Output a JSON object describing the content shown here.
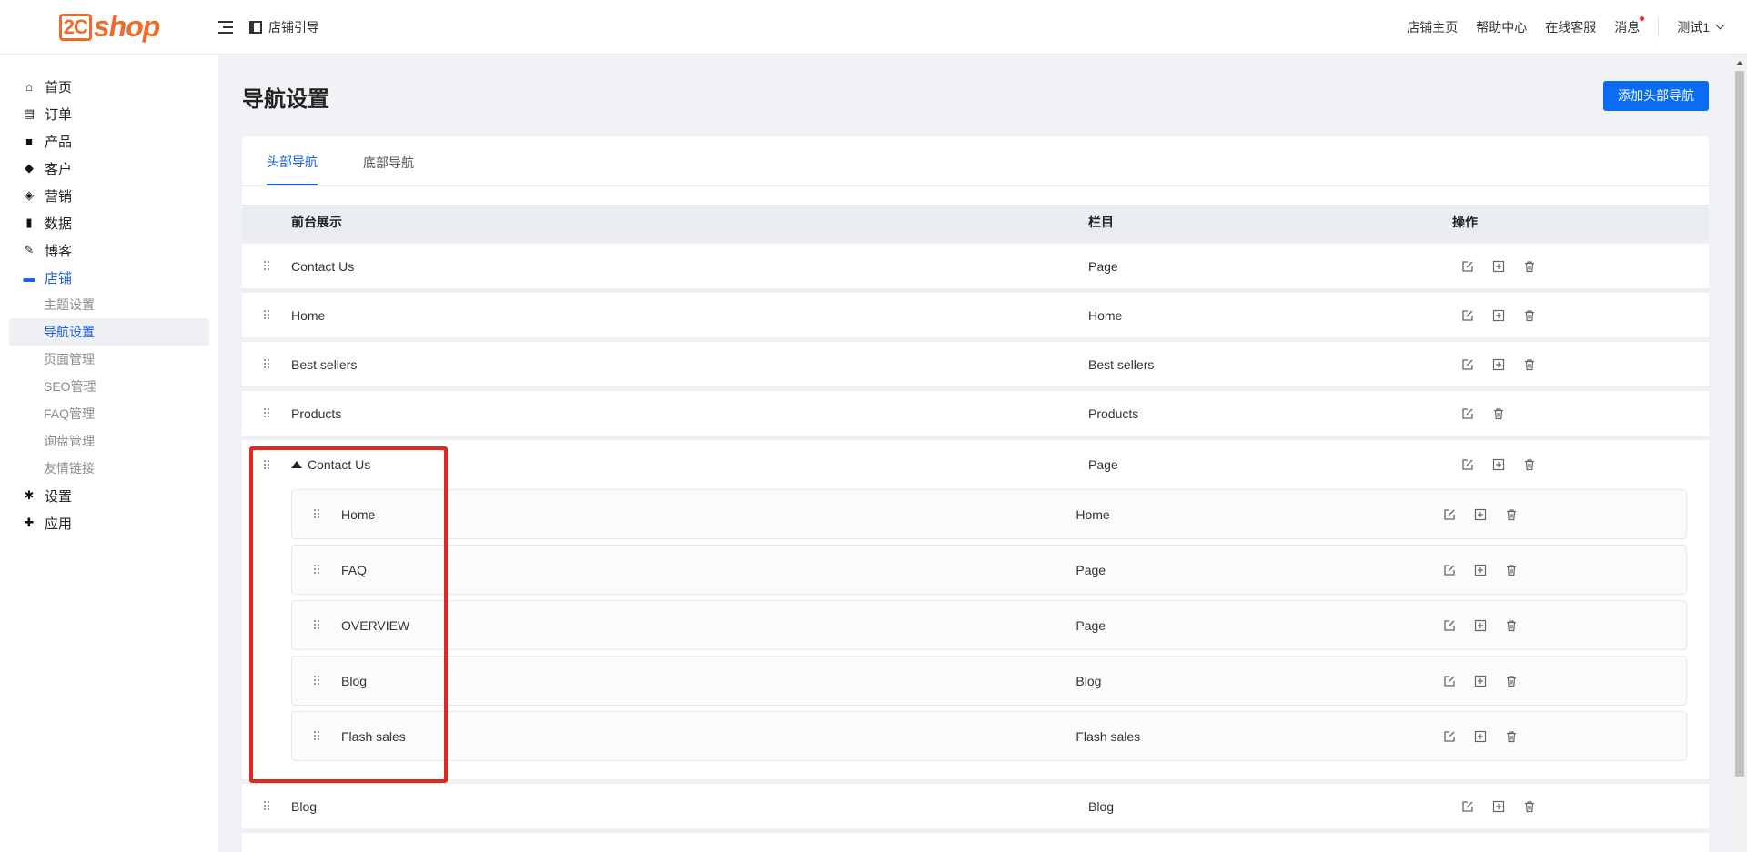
{
  "header": {
    "logo_mark": "2C",
    "logo_text": "shop",
    "breadcrumb": "店铺引导",
    "nav": [
      "店铺主页",
      "帮助中心",
      "在线客服",
      "消息"
    ],
    "user": "测试1"
  },
  "sidebar": {
    "items": [
      {
        "label": "首页",
        "icon": "home-icon"
      },
      {
        "label": "订单",
        "icon": "clipboard-icon"
      },
      {
        "label": "产品",
        "icon": "bag-icon"
      },
      {
        "label": "客户",
        "icon": "diamond-icon"
      },
      {
        "label": "营销",
        "icon": "tag-icon"
      },
      {
        "label": "数据",
        "icon": "bar-chart-icon"
      },
      {
        "label": "博客",
        "icon": "edit-note-icon"
      },
      {
        "label": "店铺",
        "icon": "store-icon"
      }
    ],
    "sub_items": [
      "主题设置",
      "导航设置",
      "页面管理",
      "SEO管理",
      "FAQ管理",
      "询盘管理",
      "友情链接"
    ],
    "bottom_items": [
      {
        "label": "设置",
        "icon": "gear-icon"
      },
      {
        "label": "应用",
        "icon": "puzzle-icon"
      }
    ]
  },
  "page": {
    "title": "导航设置",
    "add_button": "添加头部导航"
  },
  "tabs": [
    "头部导航",
    "底部导航"
  ],
  "table": {
    "headers": [
      "前台展示",
      "栏目",
      "操作"
    ],
    "rows": [
      {
        "name": "Contact Us",
        "column": "Page"
      },
      {
        "name": "Home",
        "column": "Home"
      },
      {
        "name": "Best sellers",
        "column": "Best sellers"
      },
      {
        "name": "Products",
        "column": "Products"
      }
    ],
    "group": {
      "name": "Contact Us",
      "column": "Page",
      "children": [
        {
          "name": "Home",
          "column": "Home"
        },
        {
          "name": "FAQ",
          "column": "Page"
        },
        {
          "name": "OVERVIEW",
          "column": "Page"
        },
        {
          "name": "Blog",
          "column": "Blog"
        },
        {
          "name": "Flash sales",
          "column": "Flash sales"
        }
      ]
    },
    "last_row": {
      "name": "Blog",
      "column": "Blog"
    }
  },
  "colors": {
    "primary": "#0a6cf3",
    "active": "#1a5fd8",
    "logo": "#f06a2b",
    "highlight": "#e3271d"
  }
}
